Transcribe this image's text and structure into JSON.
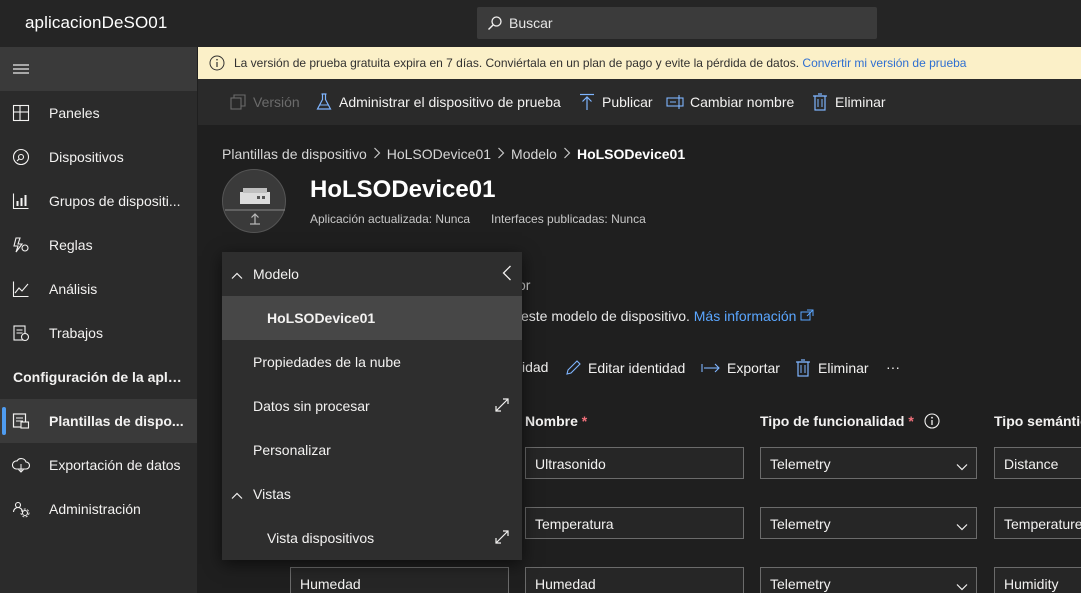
{
  "app": {
    "name": "aplicacionDeSO01"
  },
  "search": {
    "placeholder": "Buscar"
  },
  "sidebar": {
    "items": [
      {
        "label": "Paneles",
        "icon": "dashboard-icon"
      },
      {
        "label": "Dispositivos",
        "icon": "devices-icon"
      },
      {
        "label": "Grupos de dispositi...",
        "icon": "device-groups-icon"
      },
      {
        "label": "Reglas",
        "icon": "rules-icon"
      },
      {
        "label": "Análisis",
        "icon": "analytics-icon"
      },
      {
        "label": "Trabajos",
        "icon": "jobs-icon"
      }
    ],
    "section": "Configuración de la apli...",
    "config_items": [
      {
        "label": "Plantillas de dispo...",
        "icon": "device-templates-icon",
        "active": true
      },
      {
        "label": "Exportación de datos",
        "icon": "data-export-icon"
      },
      {
        "label": "Administración",
        "icon": "administration-icon"
      }
    ]
  },
  "banner": {
    "text": "La versión de prueba gratuita expira en 7 días. Conviértala en un plan de pago y evite la pérdida de datos.",
    "link": "Convertir mi versión de prueba"
  },
  "commandbar": {
    "version": "Versión",
    "manage_test_device": "Administrar el dispositivo de prueba",
    "publish": "Publicar",
    "rename": "Cambiar nombre",
    "delete": "Eliminar"
  },
  "breadcrumb": {
    "items": [
      "Plantillas de dispositivo",
      "HoLSODevice01",
      "Modelo"
    ],
    "current": "HoLSODevice01"
  },
  "header": {
    "title": "HoLSODevice01",
    "app_updated": "Aplicación actualizada: Nunca",
    "interfaces_published": "Interfaces publicadas: Nunca"
  },
  "content": {
    "partial_heading": "or",
    "desc_text": "este modelo de dispositivo.",
    "desc_link": "Más información"
  },
  "toolbar2": {
    "identity_partial": "idad",
    "edit_identity": "Editar identidad",
    "export": "Exportar",
    "delete": "Eliminar",
    "more": "···"
  },
  "columns": {
    "name": "Nombre",
    "capability_type": "Tipo de funcionalidad",
    "semantic_type": "Tipo semántico",
    "required_mark": "*"
  },
  "rows": [
    {
      "display": "",
      "name": "Ultrasonido",
      "capability": "Telemetry",
      "semantic": "Distance"
    },
    {
      "display": "",
      "name": "Temperatura",
      "capability": "Telemetry",
      "semantic": "Temperature"
    },
    {
      "display": "Humedad",
      "name": "Humedad",
      "capability": "Telemetry",
      "semantic": "Humidity"
    }
  ],
  "panel": {
    "model_header": "Modelo",
    "model_item": "HoLSODevice01",
    "cloud_properties": "Propiedades de la nube",
    "raw_data": "Datos sin procesar",
    "customize": "Personalizar",
    "views_header": "Vistas",
    "device_view": "Vista dispositivos"
  }
}
